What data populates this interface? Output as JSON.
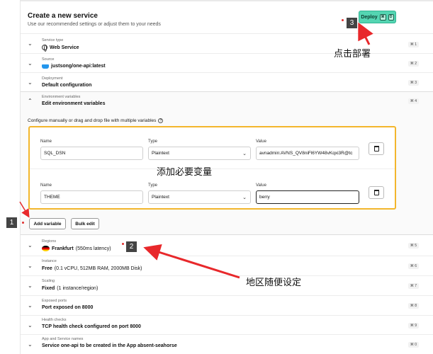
{
  "header": {
    "title": "Create a new service",
    "subtitle": "Use our recommended settings or adjust them to your needs",
    "deploy_label": "Deploy",
    "deploy_kbd_1": "⌘",
    "deploy_kbd_2": "D"
  },
  "rows": [
    {
      "label": "Service type",
      "value": "Web Service",
      "shortcut": "⌘ 1",
      "icon": "globe-icon"
    },
    {
      "label": "Source",
      "value": "justsong/one-api:latest",
      "shortcut": "⌘ 2",
      "icon": "docker-icon"
    },
    {
      "label": "Deployment",
      "value": "Default configuration",
      "shortcut": "⌘ 3"
    },
    {
      "label": "Environment variables",
      "value": "Edit environment variables",
      "shortcut": "⌘ 4"
    },
    {
      "label": "Regions",
      "value": "Frankfurt",
      "value_extra": "(550ms latency)",
      "shortcut": "⌘ 5",
      "icon": "germany-flag-icon"
    },
    {
      "label": "Instance",
      "value": "Free",
      "value_extra": "(0.1 vCPU, 512MB RAM, 2000MB Disk)",
      "shortcut": "⌘ 6"
    },
    {
      "label": "Scaling",
      "value": "Fixed",
      "value_extra": "(1 instance/region)",
      "shortcut": "⌘ 7"
    },
    {
      "label": "Exposed ports",
      "value": "Port exposed on 8000",
      "shortcut": "⌘ 8"
    },
    {
      "label": "Health checks",
      "value": "TCP health check configured on port 8000",
      "shortcut": "⌘ 9"
    },
    {
      "label": "App and Service names",
      "value": "Service one-api to be created in the App absent-seahorse",
      "shortcut": "⌘ 0"
    }
  ],
  "env": {
    "hint": "Configure manually or drag and drop file with multiple variables",
    "help_icon": "?",
    "col_name": "Name",
    "col_type": "Type",
    "col_value": "Value",
    "vars": [
      {
        "name": "SQL_DSN",
        "type": "Plaintext",
        "value": "avnadmin:AVNS_QV8niFl6YW48vKqxi3R@tc"
      },
      {
        "name": "THEME",
        "type": "Plaintext",
        "value": "berry"
      }
    ],
    "add_label": "Add variable",
    "bulk_label": "Bulk edit"
  },
  "annotations": {
    "badge_1": "1",
    "badge_2": "2",
    "badge_3": "3",
    "text_deploy": "点击部署",
    "text_vars": "添加必要变量",
    "text_region": "地区随便设定",
    "arrow_color": "#e8282b"
  }
}
